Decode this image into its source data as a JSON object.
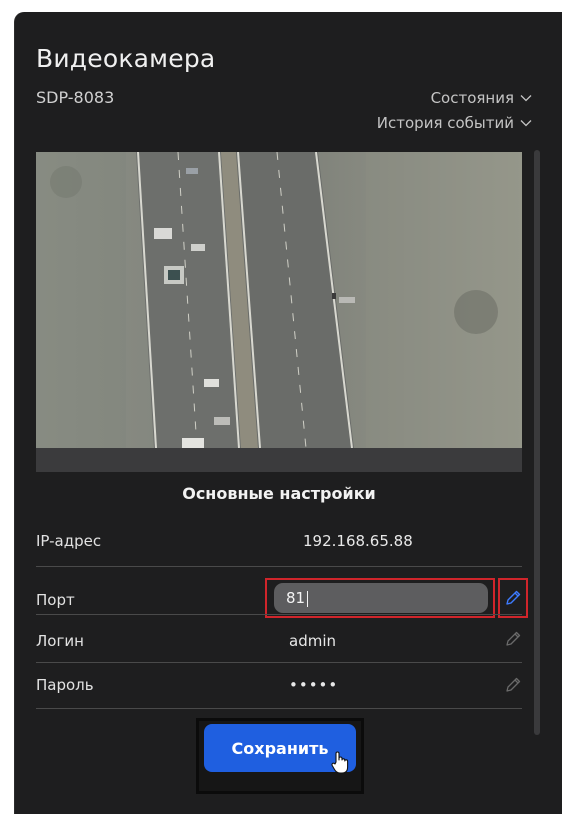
{
  "header": {
    "title": "Видеокамера",
    "device_id": "SDP-8083"
  },
  "dropdowns": [
    {
      "label": "Состояния",
      "icon": "chevron-down-icon"
    },
    {
      "label": "История событий",
      "icon": "chevron-down-icon"
    }
  ],
  "settings": {
    "title": "Основные настройки",
    "fields": {
      "ip": {
        "label": "IP-адрес",
        "value": "192.168.65.88"
      },
      "port": {
        "label": "Порт",
        "value": "81"
      },
      "login": {
        "label": "Логин",
        "value": "admin"
      },
      "password": {
        "label": "Пароль",
        "value": "•••••"
      }
    }
  },
  "actions": {
    "save_label": "Сохранить"
  },
  "colors": {
    "panel_bg": "#1e1e1f",
    "accent": "#1f5fe0",
    "highlight": "#d0252b",
    "edit_active": "#3d7bff"
  }
}
